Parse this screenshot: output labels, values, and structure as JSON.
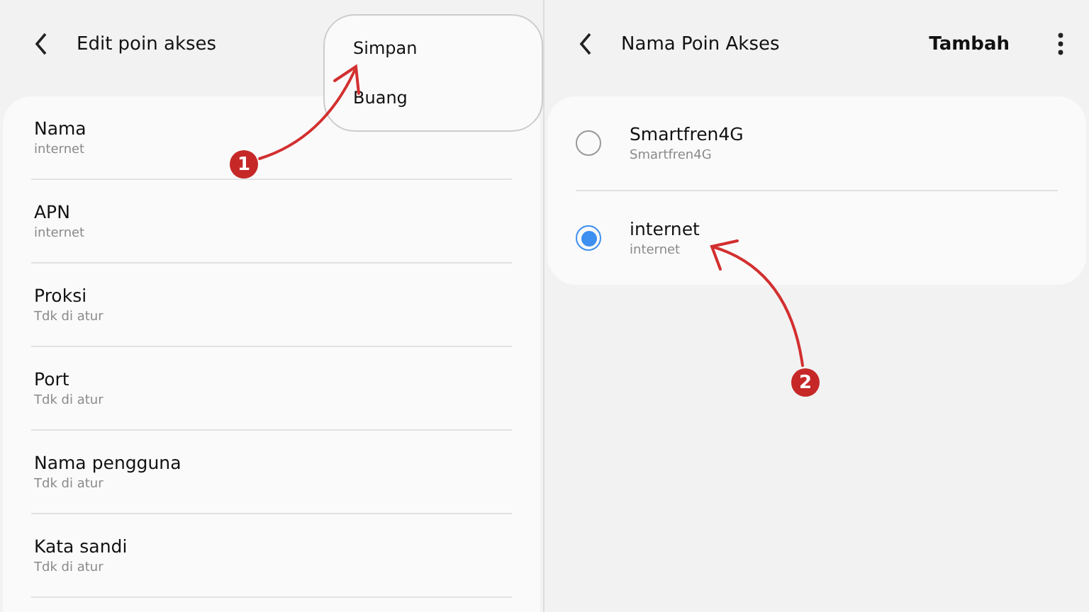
{
  "left_screen": {
    "title": "Edit poin akses",
    "fields": [
      {
        "label": "Nama",
        "value": "internet"
      },
      {
        "label": "APN",
        "value": "internet"
      },
      {
        "label": "Proksi",
        "value": "Tdk di atur"
      },
      {
        "label": "Port",
        "value": "Tdk di atur"
      },
      {
        "label": "Nama pengguna",
        "value": "Tdk di atur"
      },
      {
        "label": "Kata sandi",
        "value": "Tdk di atur"
      }
    ],
    "menu": [
      "Simpan",
      "Buang"
    ]
  },
  "right_screen": {
    "title": "Nama Poin Akses",
    "action": "Tambah",
    "access_points": [
      {
        "name": "Smartfren4G",
        "apn": "Smartfren4G",
        "selected": false
      },
      {
        "name": "internet",
        "apn": "internet",
        "selected": true
      }
    ]
  },
  "annotations": [
    "1",
    "2"
  ]
}
